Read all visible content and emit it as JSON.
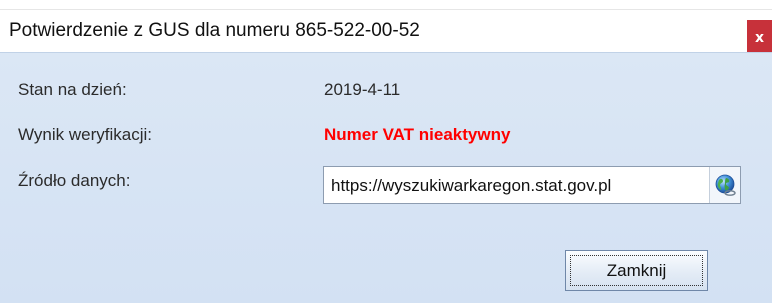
{
  "window": {
    "title": "Potwierdzenie z GUS dla numeru 865-522-00-52",
    "close_symbol": "x"
  },
  "fields": {
    "date_label": "Stan na dzień:",
    "date_value": "2019-4-11",
    "result_label": "Wynik weryfikacji:",
    "result_value": "Numer VAT nieaktywny",
    "source_label": "Źródło danych:",
    "source_url": "https://wyszukiwarkaregon.stat.gov.pl"
  },
  "icons": {
    "open_url": "globe-icon"
  },
  "buttons": {
    "close_label": "Zamknij"
  },
  "colors": {
    "error_text": "#ff0000",
    "close_button": "#c7313a",
    "panel_background": "#d7e4f4"
  }
}
